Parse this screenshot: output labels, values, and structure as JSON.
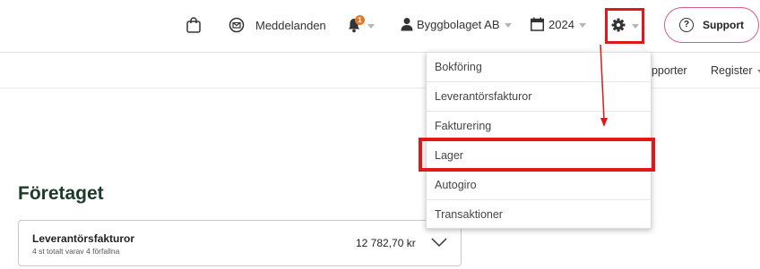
{
  "topbar": {
    "messages_label": "Meddelanden",
    "notification_count": "1",
    "company_label": "Byggbolaget AB",
    "year_label": "2024",
    "support_label": "Support",
    "support_symbol": "?"
  },
  "subnav": {
    "reports_label": "apporter",
    "register_label": "Register"
  },
  "settings_menu": {
    "items": [
      "Bokföring",
      "Leverantörsfakturor",
      "Fakturering",
      "Lager",
      "Autogiro",
      "Transaktioner"
    ],
    "highlighted": "Lager"
  },
  "main": {
    "page_title": "Företaget",
    "card": {
      "title": "Leverantörsfakturor",
      "subtitle": "4 st totalt varav 4 förfallna",
      "amount": "12 782,70 kr"
    }
  },
  "colors": {
    "highlight_red": "#e01818",
    "support_border": "#d45a8a",
    "badge": "#e07a2b",
    "title_green": "#1d3a2a"
  },
  "icons": [
    "shopping-bag-icon",
    "envelope-icon",
    "bell-icon",
    "user-icon",
    "calendar-icon",
    "gear-icon",
    "question-icon",
    "chevron-down-icon",
    "arrow-annotation"
  ]
}
